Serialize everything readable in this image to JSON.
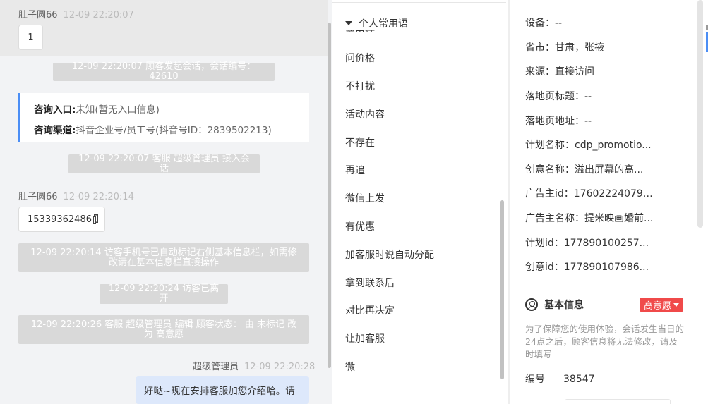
{
  "chat": {
    "messages": {
      "m1": {
        "sender": "肚子圆66",
        "time": "12-09 22:20:07",
        "text": "1"
      },
      "sys1": "12-09 22:20:07 顾客发起会话，会话编号：42610",
      "card": {
        "entry_label": "咨询入口:",
        "entry_value": "未知(暂无入口信息)",
        "channel_label": "咨询渠道:",
        "channel_value": "抖音企业号/员工号(抖音号ID：2839502213)"
      },
      "sys2": "12-09 22:20:07 客服 超级管理员 接入会话",
      "m2": {
        "sender": "肚子圆66",
        "time": "12-09 22:20:14",
        "text": "15339362486"
      },
      "sys3": "12-09 22:20:14 访客手机号已自动标记右侧基本信息栏，如需修改请在基本信息栏直接操作",
      "sys4": "12-09 22:20:24 访客已离开",
      "sys5": "12-09 22:20:26 客服 超级管理员 编辑 顾客状态： 由 未标记 改为 高意愿",
      "m3": {
        "sender": "超级管理员",
        "time": "12-09 22:20:28",
        "text": "好哒~现在安排客服加您介绍哈。请"
      }
    }
  },
  "phrases": {
    "group_title": "个人常用语",
    "cut_item": "要电话",
    "items": [
      "问价格",
      "不打扰",
      "活动内容",
      "不存在",
      "再追",
      "微信上发",
      "有优惠",
      "加客服时说自动分配",
      "拿到联系后",
      "对比再决定",
      "让加客服",
      "微"
    ]
  },
  "info": {
    "device": "设备：--",
    "province": "省市：甘肃，张掖",
    "source": "来源：直接访问",
    "landing_title": "落地页标题：--",
    "landing_url": "落地页地址：--",
    "plan_name": "计划名称：cdp_promotio...",
    "creative_name": "创意名称：溢出屏幕的高...",
    "advertiser_id": "广告主id：176022240796...",
    "advertiser_name": "广告主名称：提米映画婚前...",
    "plan_id": "计划id：177890100257...",
    "creative_id": "创意id：177890107986...",
    "basic_title": "基本信息",
    "intent_badge": "高意愿",
    "notice": "为了保障您的使用体验，会话发生当日的24点之后，顾客信息将无法修改，请及时填写",
    "number_label": "编号",
    "number_value": "38547"
  },
  "colors": {
    "accent": "#4b8ef5",
    "badge": "#f04a4a",
    "system_bg": "#d9d9d9",
    "agent_bubble": "#dde8fb"
  }
}
